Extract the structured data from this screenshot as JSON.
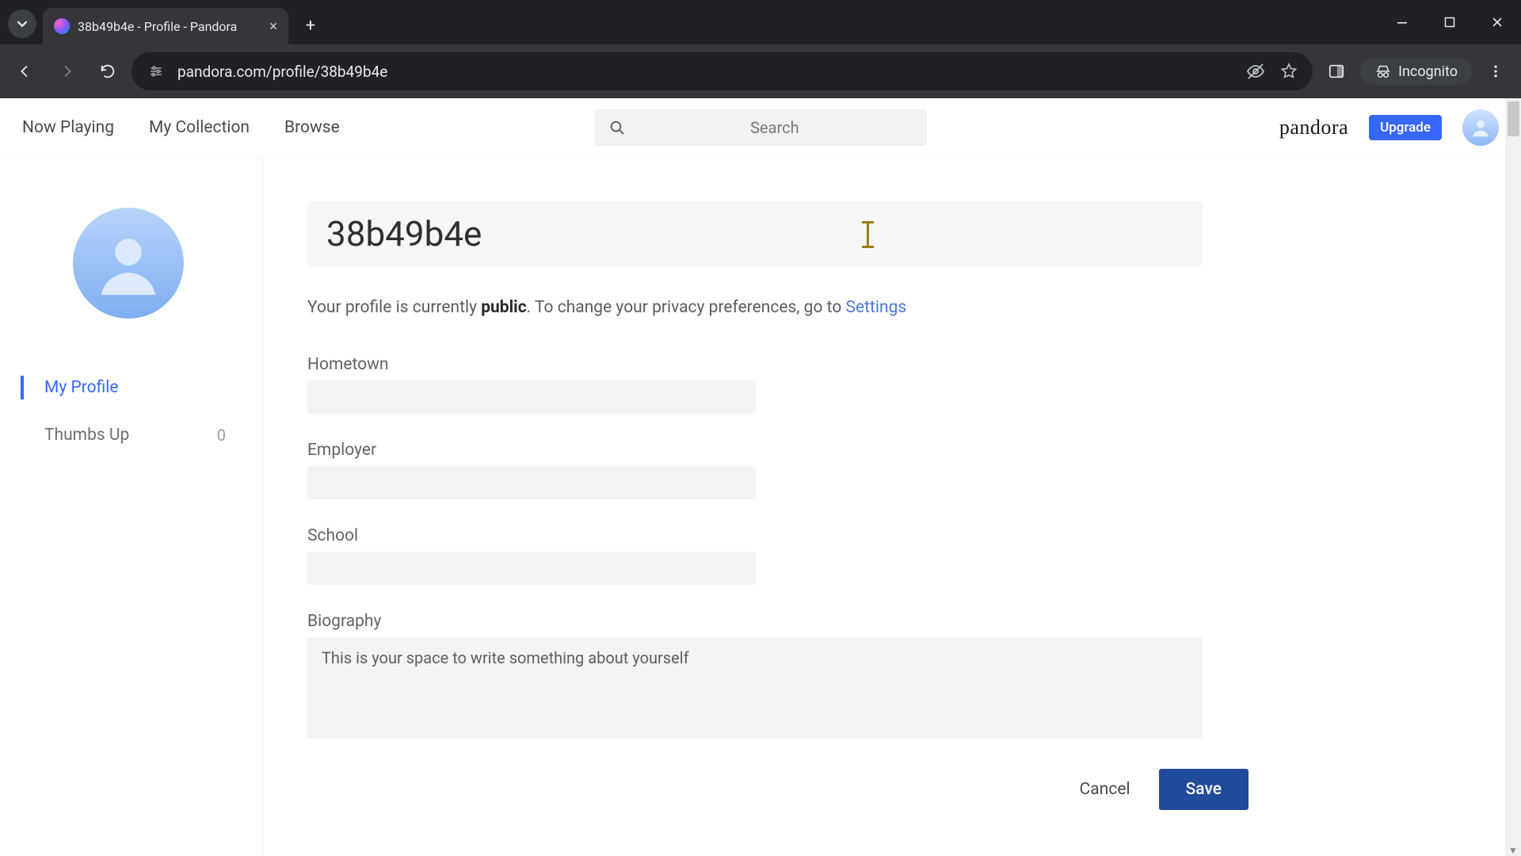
{
  "browser": {
    "tab_title": "38b49b4e - Profile - Pandora",
    "url": "pandora.com/profile/38b49b4e",
    "incognito_label": "Incognito"
  },
  "header": {
    "nav": {
      "now_playing": "Now Playing",
      "my_collection": "My Collection",
      "browse": "Browse"
    },
    "search_placeholder": "Search",
    "brand": "pandora",
    "upgrade_label": "Upgrade"
  },
  "sidebar": {
    "items": [
      {
        "label": "My Profile"
      },
      {
        "label": "Thumbs Up",
        "count": "0"
      }
    ]
  },
  "profile": {
    "display_name": "38b49b4e",
    "privacy_prefix": "Your profile is currently ",
    "privacy_status": "public",
    "privacy_middle": ". To change your privacy preferences, go to ",
    "privacy_link": "Settings",
    "fields": {
      "hometown_label": "Hometown",
      "hometown_value": "",
      "employer_label": "Employer",
      "employer_value": "",
      "school_label": "School",
      "school_value": "",
      "biography_label": "Biography",
      "biography_value": "",
      "biography_placeholder": "This is your space to write something about yourself"
    },
    "actions": {
      "cancel": "Cancel",
      "save": "Save"
    }
  }
}
